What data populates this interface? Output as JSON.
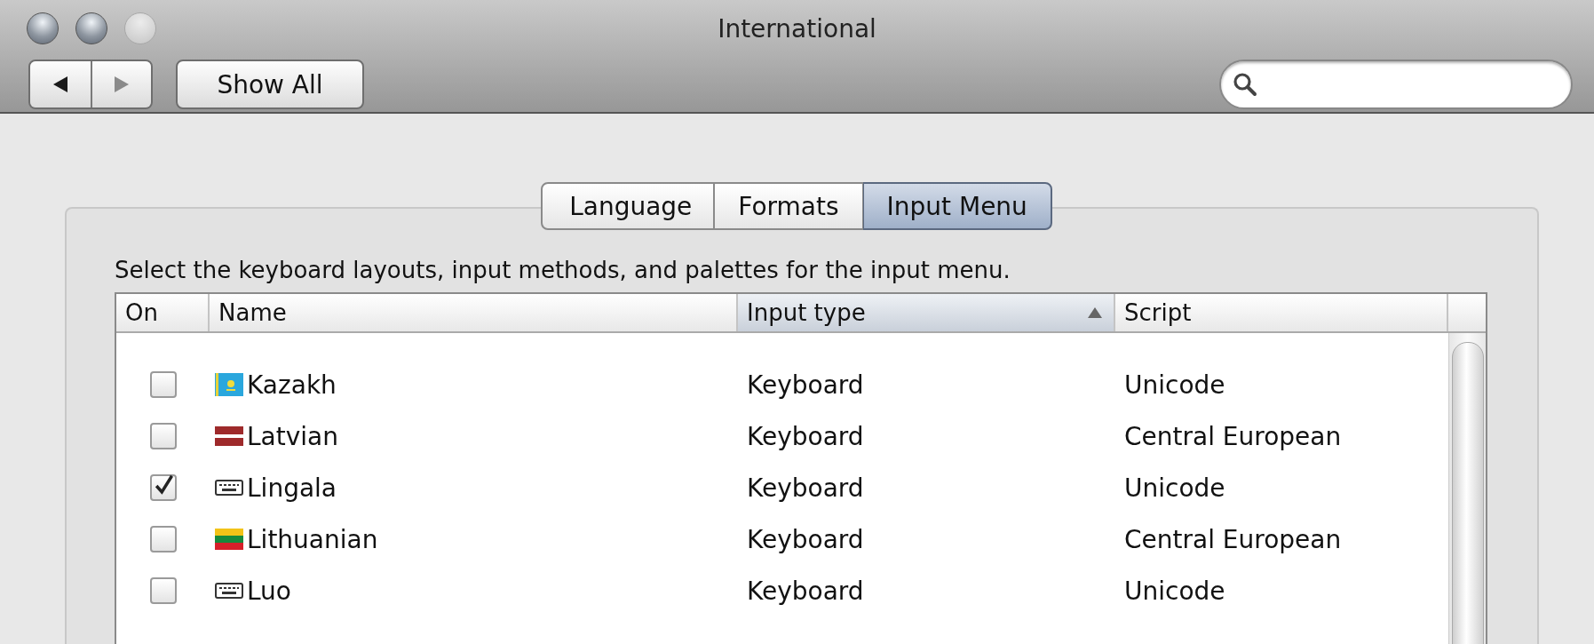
{
  "window": {
    "title": "International"
  },
  "toolbar": {
    "show_all": "Show All"
  },
  "tabs": [
    {
      "label": "Language",
      "selected": false
    },
    {
      "label": "Formats",
      "selected": false
    },
    {
      "label": "Input Menu",
      "selected": true
    }
  ],
  "instruction": "Select the keyboard layouts, input methods, and palettes for the input menu.",
  "table": {
    "columns": [
      {
        "label": "On",
        "sorted": false
      },
      {
        "label": "Name",
        "sorted": false
      },
      {
        "label": "Input type",
        "sorted": true
      },
      {
        "label": "Script",
        "sorted": false
      }
    ],
    "rows": [
      {
        "kind": "kazakh",
        "checked": false,
        "name": "Kazakh",
        "input_type": "Keyboard",
        "script": "Unicode"
      },
      {
        "kind": "latvian",
        "checked": false,
        "name": "Latvian",
        "input_type": "Keyboard",
        "script": "Central European"
      },
      {
        "kind": "keyboard",
        "checked": true,
        "name": "Lingala",
        "input_type": "Keyboard",
        "script": "Unicode"
      },
      {
        "kind": "lithuanian",
        "checked": false,
        "name": "Lithuanian",
        "input_type": "Keyboard",
        "script": "Central European"
      },
      {
        "kind": "keyboard",
        "checked": false,
        "name": "Luo",
        "input_type": "Keyboard",
        "script": "Unicode"
      }
    ]
  }
}
